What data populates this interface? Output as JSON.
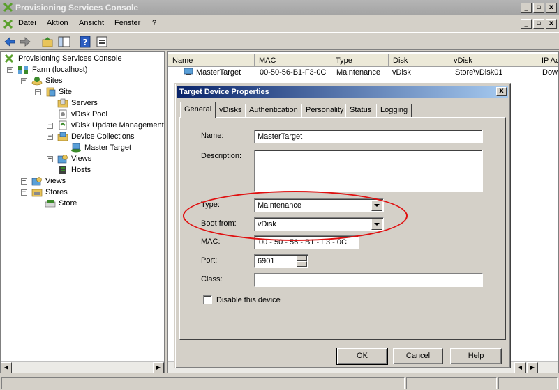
{
  "window": {
    "title": "Provisioning Services Console",
    "min": "_",
    "max": "▫",
    "close": "x"
  },
  "menu": [
    "Datei",
    "Aktion",
    "Ansicht",
    "Fenster",
    "?"
  ],
  "tree": {
    "root": "Provisioning Services Console",
    "farm": "Farm (localhost)",
    "sites": "Sites",
    "site": "Site",
    "servers": "Servers",
    "vdisk_pool": "vDisk Pool",
    "vdisk_update": "vDisk Update Management",
    "device_collections": "Device Collections",
    "master_target": "Master Target",
    "views_site": "Views",
    "hosts": "Hosts",
    "views": "Views",
    "stores": "Stores",
    "store": "Store"
  },
  "list": {
    "columns": [
      "Name",
      "MAC",
      "Type",
      "Disk",
      "vDisk",
      "IP Ac"
    ],
    "rows": [
      {
        "name": "MasterTarget",
        "mac": "00-50-56-B1-F3-0C",
        "type": "Maintenance",
        "disk": "vDisk",
        "vdisk": "Store\\vDisk01",
        "ip": "Dow"
      }
    ]
  },
  "dialog": {
    "title": "Target Device Properties",
    "close": "x",
    "tabs": [
      "General",
      "vDisks",
      "Authentication",
      "Personality",
      "Status",
      "Logging"
    ],
    "labels": {
      "name": "Name:",
      "description": "Description:",
      "type": "Type:",
      "boot_from": "Boot from:",
      "mac": "MAC:",
      "port": "Port:",
      "class": "Class:"
    },
    "values": {
      "name": "MasterTarget",
      "description": "",
      "type": "Maintenance",
      "boot_from": "vDisk",
      "mac": "00 - 50 - 56 - B1 - F3 - 0C",
      "port": "6901",
      "class": ""
    },
    "disable_label": "Disable this device",
    "buttons": {
      "ok": "OK",
      "cancel": "Cancel",
      "help": "Help"
    }
  },
  "scroll": {
    "left": "◀",
    "right": "▶"
  },
  "colors": {
    "annotation": "#e01010",
    "dialog_title": "#0a246a"
  }
}
